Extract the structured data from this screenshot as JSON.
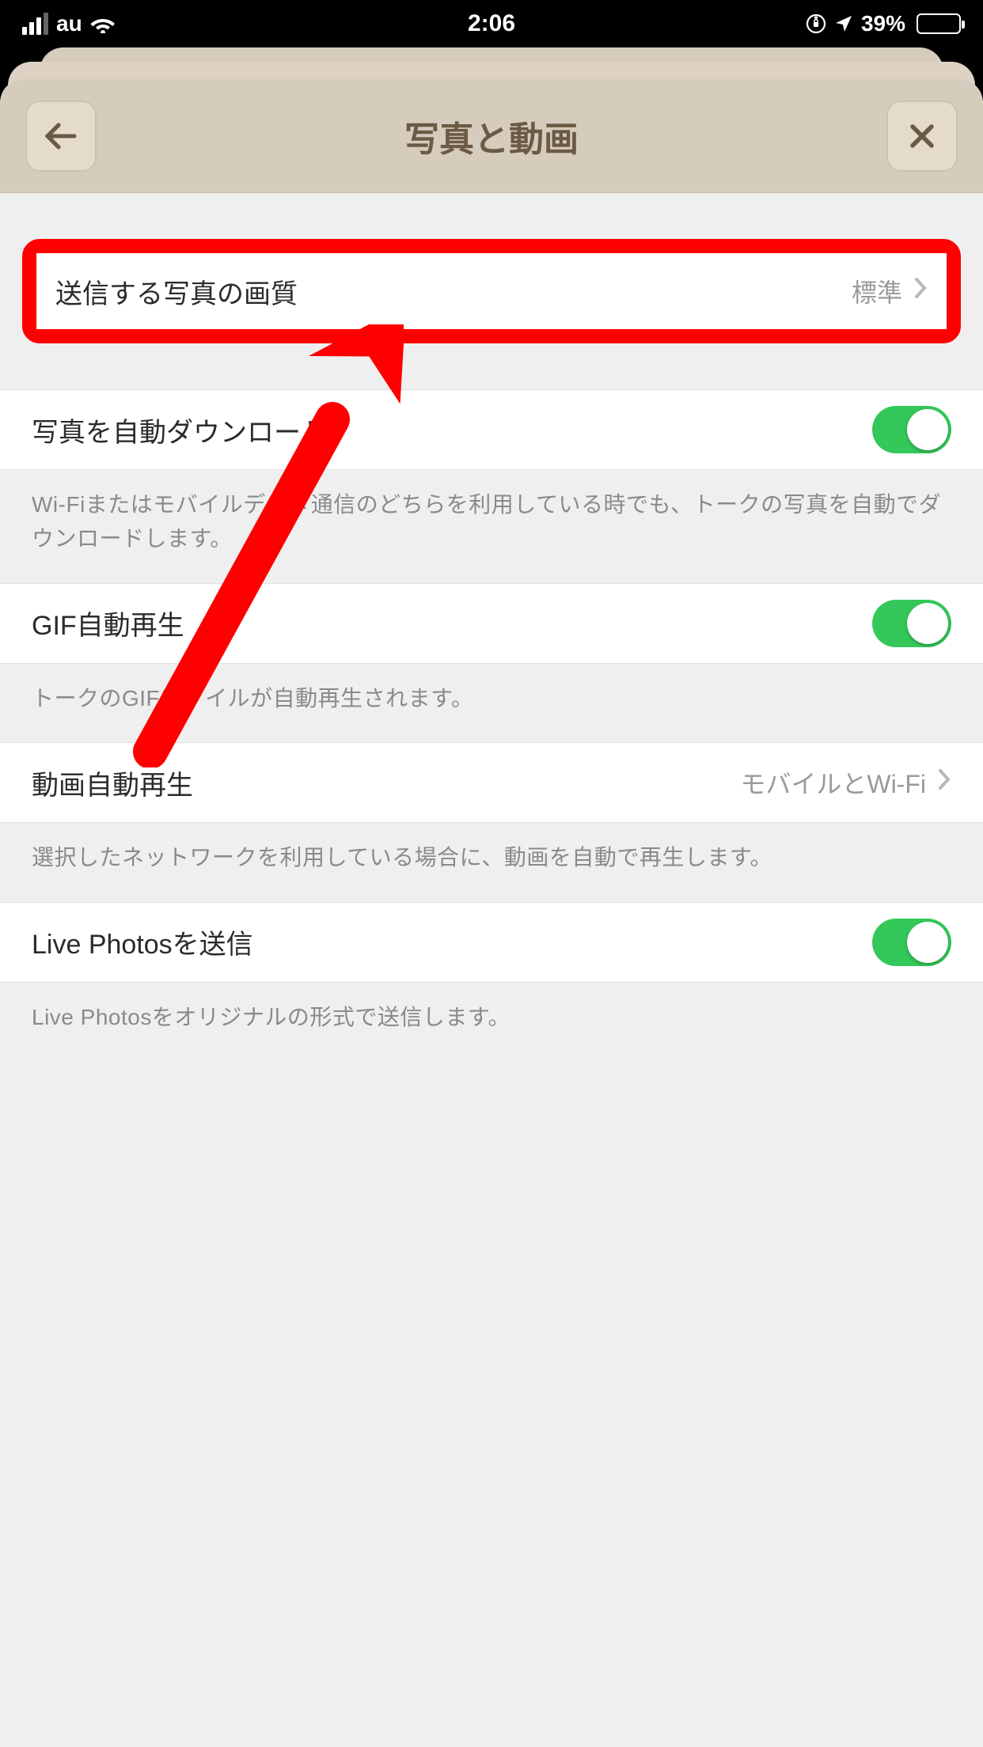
{
  "status": {
    "carrier": "au",
    "time": "2:06",
    "battery_pct": "39%"
  },
  "nav": {
    "title": "写真と動画"
  },
  "rows": {
    "quality": {
      "label": "送信する写真の画質",
      "value": "標準"
    },
    "auto_dl": {
      "label": "写真を自動ダウンロード",
      "desc": "Wi-Fiまたはモバイルデータ通信のどちらを利用している時でも、トークの写真を自動でダウンロードします。"
    },
    "gif": {
      "label": "GIF自動再生",
      "desc": "トークのGIFファイルが自動再生されます。"
    },
    "video": {
      "label": "動画自動再生",
      "value": "モバイルとWi-Fi",
      "desc": "選択したネットワークを利用している場合に、動画を自動で再生します。"
    },
    "live": {
      "label": "Live Photosを送信",
      "desc": "Live Photosをオリジナルの形式で送信します。"
    }
  }
}
